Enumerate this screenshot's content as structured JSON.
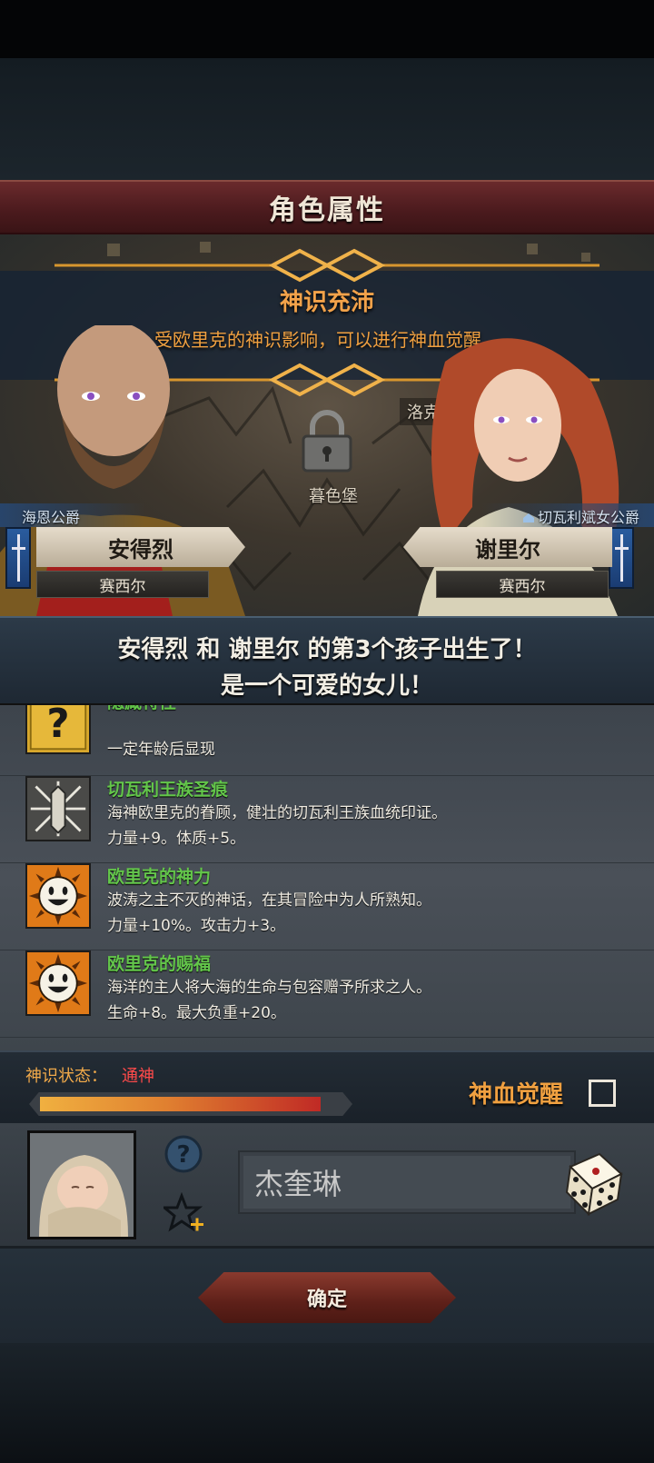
{
  "header": {
    "title": "角色属性"
  },
  "event": {
    "title": "神识充沛",
    "description": "受欧里克的神识影响，可以进行神血觉醒。"
  },
  "map": {
    "places": [
      "洛克斯堡",
      "暮色堡"
    ]
  },
  "father": {
    "name": "安得烈",
    "title": "海恩公爵",
    "house": "赛西尔"
  },
  "mother": {
    "name": "谢里尔",
    "title": "切瓦利斌女公爵",
    "house": "赛西尔"
  },
  "announcement": {
    "line1": "安得烈 和 谢里尔 的第3个孩子出生了！",
    "line2": "是一个可爱的女儿！"
  },
  "traits": [
    {
      "icon": "question-mark-icon",
      "name": "隐藏特性",
      "desc": "",
      "effect": "一定年龄后显现"
    },
    {
      "icon": "royal-scar-icon",
      "name": "切瓦利王族圣痕",
      "desc": "海神欧里克的眷顾，健壮的切瓦利王族血统印证。",
      "effect": "力量+9。体质+5。"
    },
    {
      "icon": "smiling-sun-icon",
      "name": "欧里克的神力",
      "desc": "波涛之主不灭的神话，在其冒险中为人所熟知。",
      "effect": "力量+10%。攻击力+3。"
    },
    {
      "icon": "smiling-sun-icon",
      "name": "欧里克的赐福",
      "desc": "海洋的主人将大海的生命与包容赠予所求之人。",
      "effect": "生命+8。最大负重+20。"
    }
  ],
  "status": {
    "label": "神识状态：",
    "value": "通神",
    "meter_fraction": 0.93,
    "awaken_label": "神血觉醒",
    "awaken_checked": false
  },
  "child": {
    "name_value": "杰奎琳"
  },
  "footer": {
    "confirm_label": "确定"
  },
  "colors": {
    "accent_orange": "#f0a040",
    "trait_green": "#63c64a",
    "status_red": "#ff4a4a",
    "title_bar": "#5a2226"
  }
}
